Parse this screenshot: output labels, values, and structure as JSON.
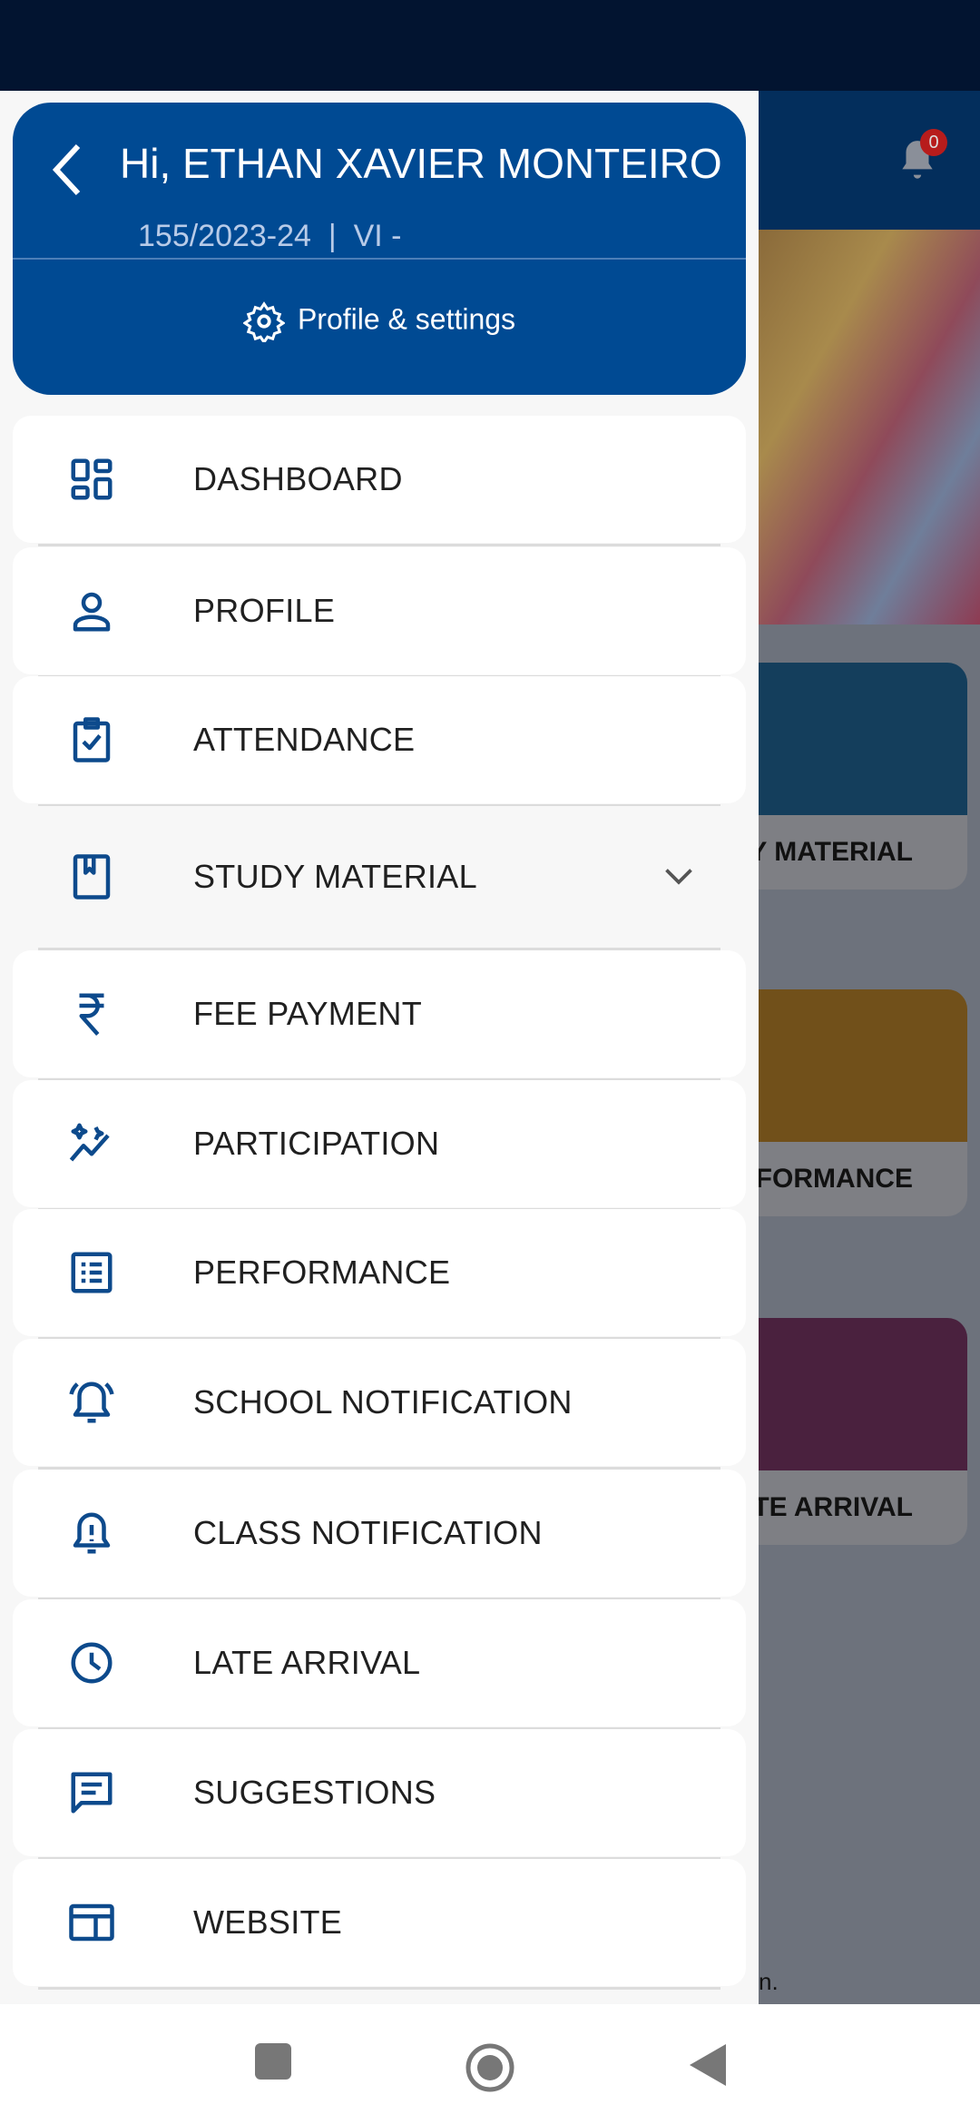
{
  "header": {
    "greeting": "Hi, ETHAN XAVIER MONTEIRO",
    "subtitle": "155/2023-24  |  VI -",
    "profile_settings": "Profile & settings"
  },
  "menu": [
    {
      "label": "DASHBOARD",
      "icon": "dashboard-icon"
    },
    {
      "label": "PROFILE",
      "icon": "person-icon"
    },
    {
      "label": "ATTENDANCE",
      "icon": "clipboard-check-icon"
    },
    {
      "label": "STUDY MATERIAL",
      "icon": "book-icon",
      "expandable": true
    },
    {
      "label": "FEE PAYMENT",
      "icon": "rupee-icon"
    },
    {
      "label": "PARTICIPATION",
      "icon": "sparkle-chart-icon"
    },
    {
      "label": "PERFORMANCE",
      "icon": "list-icon"
    },
    {
      "label": "SCHOOL NOTIFICATION",
      "icon": "bell-ring-icon"
    },
    {
      "label": "CLASS NOTIFICATION",
      "icon": "bell-alert-icon"
    },
    {
      "label": "LATE ARRIVAL",
      "icon": "clock-icon"
    },
    {
      "label": "SUGGESTIONS",
      "icon": "message-icon"
    },
    {
      "label": "WEBSITE",
      "icon": "web-icon"
    }
  ],
  "background": {
    "notification_count": "0",
    "tiles": [
      "DY MATERIAL",
      "RFORMANCE",
      "TE ARRIVAL"
    ],
    "footer_fragment": "n."
  },
  "colors": {
    "primary": "#004a93",
    "status_bar": "#021430",
    "icon": "#0d4a8c"
  }
}
